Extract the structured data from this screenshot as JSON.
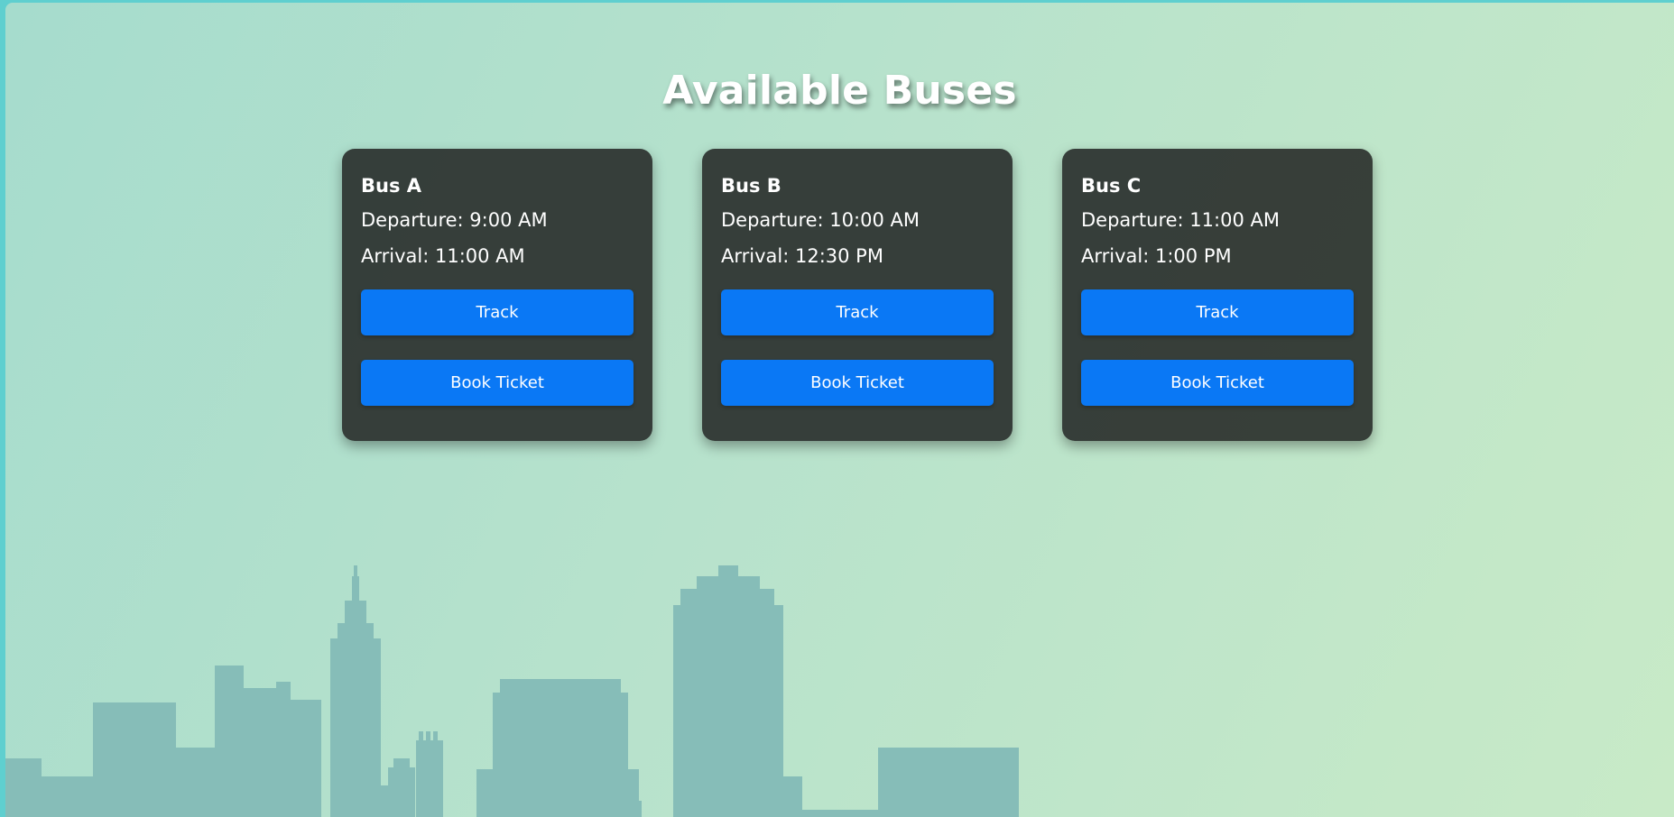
{
  "page": {
    "title": "Available Buses"
  },
  "buses": [
    {
      "name": "Bus A",
      "departure": "Departure: 9:00 AM",
      "arrival": "Arrival: 11:00 AM",
      "track_label": "Track",
      "book_label": "Book Ticket"
    },
    {
      "name": "Bus B",
      "departure": "Departure: 10:00 AM",
      "arrival": "Arrival: 12:30 PM",
      "track_label": "Track",
      "book_label": "Book Ticket"
    },
    {
      "name": "Bus C",
      "departure": "Departure: 11:00 AM",
      "arrival": "Arrival: 1:00 PM",
      "track_label": "Track",
      "book_label": "Book Ticket"
    }
  ],
  "colors": {
    "background_start": "#a6dccd",
    "background_end": "#c8eac7",
    "card_bg": "#2c322e",
    "button": "#0a78f5",
    "skyline": "#86bdb8",
    "window_frame": "#5fcfcf"
  },
  "decor": {
    "skyline": "city-skyline-silhouette"
  }
}
